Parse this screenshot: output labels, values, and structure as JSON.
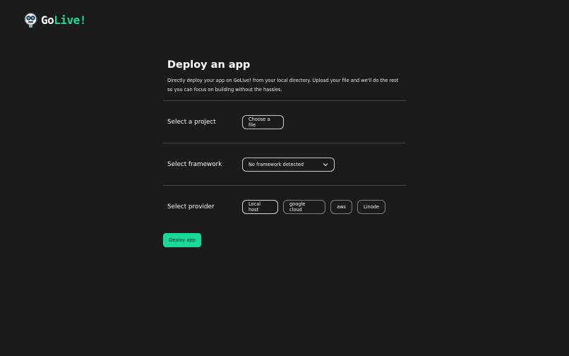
{
  "brand": {
    "name_part1": "Go",
    "name_part2": "Live!",
    "accent_color": "#19d99a",
    "logo_icon": "robot-mascot-icon"
  },
  "header": {
    "title": "Deploy an app",
    "description": "Directly deploy your app on GoLive! from your local directory. Upload your file and we'll do the rest so you can focus on building without the hassles."
  },
  "project": {
    "label": "Select a project",
    "button_label": "Choose a file"
  },
  "framework": {
    "label": "Select framework",
    "selected": "No framework detected",
    "icon": "chevron-down-icon"
  },
  "provider": {
    "label": "Select provider",
    "options": [
      "Local host",
      "google cloud",
      "aws",
      "Linode"
    ],
    "selected": "Local host"
  },
  "actions": {
    "deploy_label": "Deploy app"
  }
}
